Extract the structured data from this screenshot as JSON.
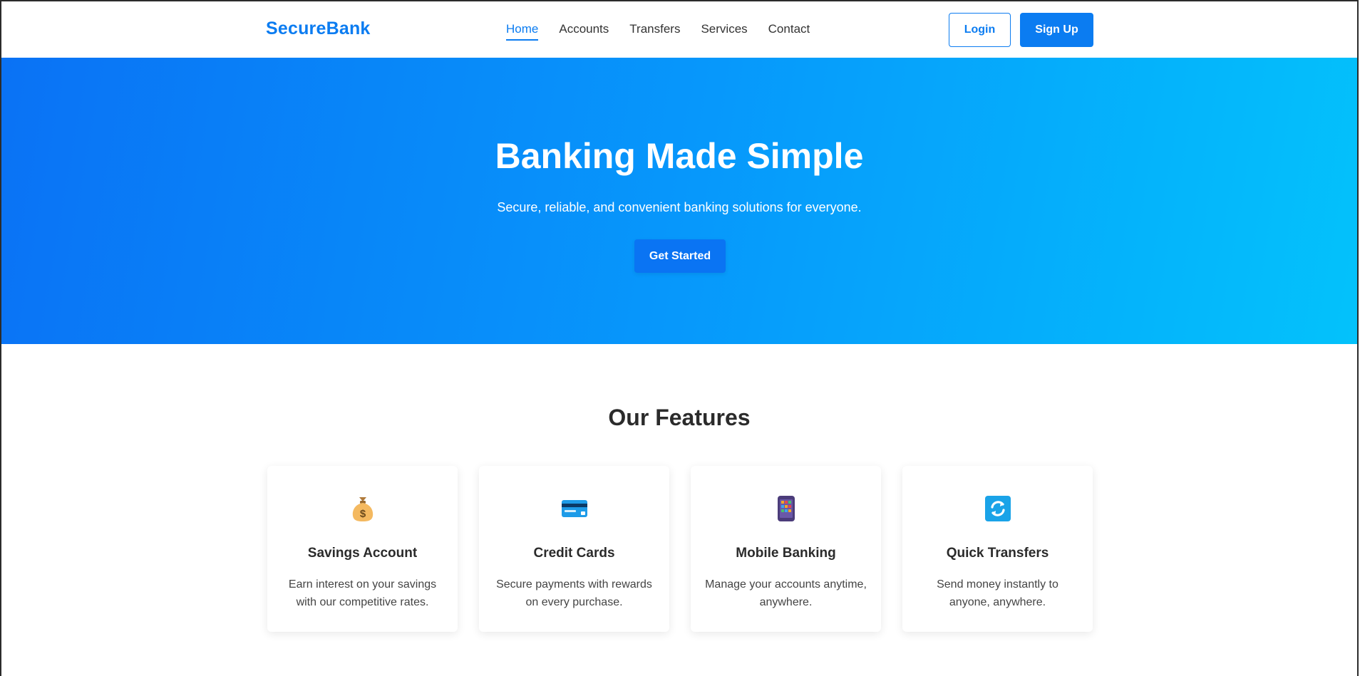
{
  "header": {
    "brand": "SecureBank",
    "nav": [
      {
        "label": "Home",
        "active": true
      },
      {
        "label": "Accounts",
        "active": false
      },
      {
        "label": "Transfers",
        "active": false
      },
      {
        "label": "Services",
        "active": false
      },
      {
        "label": "Contact",
        "active": false
      }
    ],
    "login_label": "Login",
    "signup_label": "Sign Up"
  },
  "hero": {
    "title": "Banking Made Simple",
    "subtitle": "Secure, reliable, and convenient banking solutions for everyone.",
    "cta_label": "Get Started"
  },
  "features": {
    "title": "Our Features",
    "items": [
      {
        "icon": "money-bag-icon",
        "title": "Savings Account",
        "description": "Earn interest on your savings with our competitive rates."
      },
      {
        "icon": "credit-card-icon",
        "title": "Credit Cards",
        "description": "Secure payments with rewards on every purchase."
      },
      {
        "icon": "mobile-phone-icon",
        "title": "Mobile Banking",
        "description": "Manage your accounts anytime, anywhere."
      },
      {
        "icon": "transfer-arrows-icon",
        "title": "Quick Transfers",
        "description": "Send money instantly to anyone, anywhere."
      }
    ]
  },
  "colors": {
    "primary": "#0b7cf1",
    "hero_gradient_start": "#0a72f5",
    "hero_gradient_end": "#03c2fb",
    "text_dark": "#2b2b2b"
  }
}
